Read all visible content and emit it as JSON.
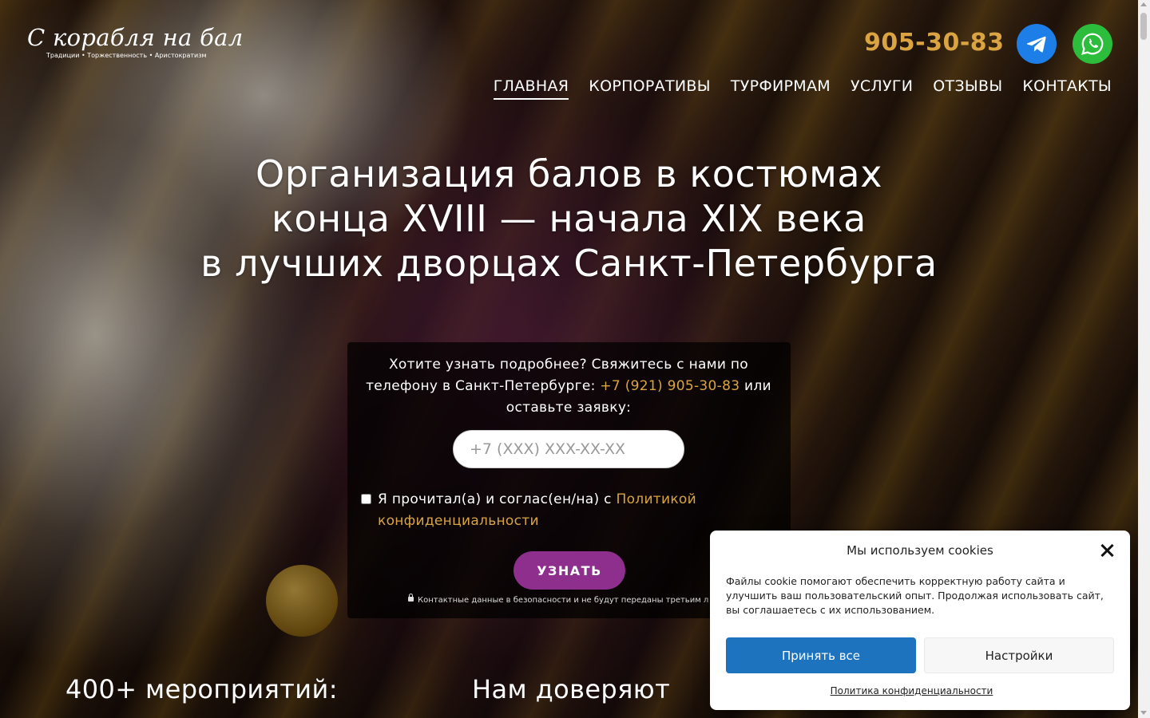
{
  "logo": {
    "title": "С корабля на бал",
    "tagline": "Традиции • Торжественность • Аристократизм"
  },
  "header": {
    "phone": "905-30-83",
    "telegram_icon": "telegram-icon",
    "whatsapp_icon": "whatsapp-icon",
    "colors": {
      "phone": "#d9a441",
      "telegram": "#1e7ee8",
      "whatsapp": "#2dbd3c"
    }
  },
  "nav": {
    "items": [
      {
        "label": "ГЛАВНАЯ",
        "active": true
      },
      {
        "label": "КОРПОРАТИВЫ",
        "active": false
      },
      {
        "label": "ТУРФИРМАМ",
        "active": false
      },
      {
        "label": "УСЛУГИ",
        "active": false
      },
      {
        "label": "ОТЗЫВЫ",
        "active": false
      },
      {
        "label": "КОНТАКТЫ",
        "active": false
      }
    ]
  },
  "hero": {
    "line1": "Организация балов в костюмах",
    "line2": "конца XVIII — начала XIX века",
    "line3": "в лучших дворцах Санкт-Петербурга"
  },
  "form": {
    "intro_before": "Хотите узнать подробнее? Свяжитесь с нами по телефону в Санкт-Петербурге: ",
    "intro_phone": "+7 (921) 905-30-83",
    "intro_after": " или оставьте заявку:",
    "phone_placeholder": "+7 (XXX) XXX-XX-XX",
    "consent_before": "Я прочитал(а) и соглас(ен/на) с ",
    "consent_link": "Политикой конфиденциальности",
    "consent_checked": false,
    "submit_label": "УЗНАТЬ",
    "secure_note": "Контактные данные в безопасности и не будут переданы третьим л",
    "colors": {
      "submit": "#8e2f8e",
      "link": "#d9a441"
    }
  },
  "stats": {
    "events_heading": "400+ мероприятий:",
    "trust_heading": "Нам доверяют"
  },
  "cookie": {
    "title": "Мы используем cookies",
    "text": "Файлы cookie помогают обеспечить корректную работу сайта и улучшить ваш пользовательский опыт. Продолжая использовать сайт, вы соглашаетесь с их использованием.",
    "accept_label": "Принять все",
    "settings_label": "Настройки",
    "policy_link": "Политика конфиденциальности",
    "close_icon": "close-icon",
    "colors": {
      "accept": "#1e73be"
    }
  }
}
